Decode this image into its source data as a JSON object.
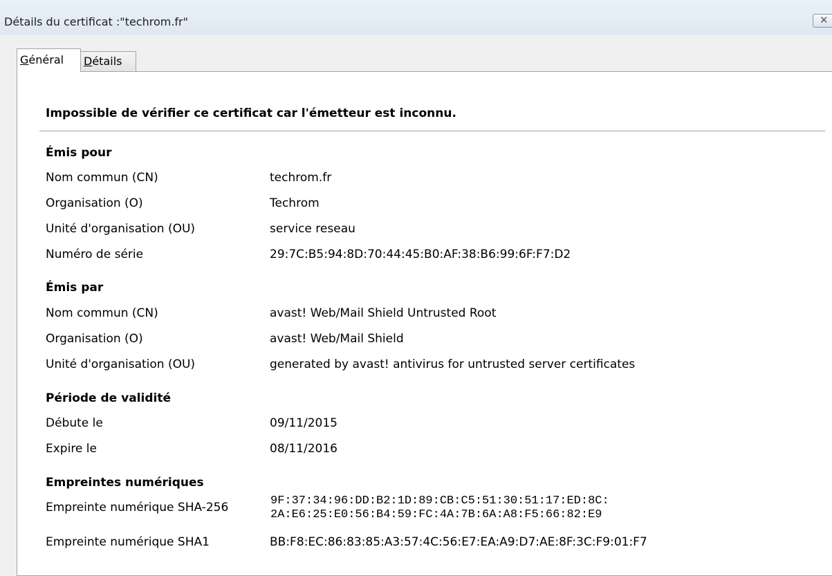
{
  "window": {
    "title": "Détails du certificat :\"techrom.fr\"",
    "close_glyph": "✕"
  },
  "tabs": [
    {
      "label": "Général",
      "underline": "G",
      "rest": "énéral",
      "selected": true
    },
    {
      "label": "Détails",
      "underline": "D",
      "rest": "étails",
      "selected": false
    }
  ],
  "warning": "Impossible de vérifier ce certificat car l'émetteur est inconnu.",
  "issued_to": {
    "heading": "Émis pour",
    "rows": [
      {
        "label": "Nom commun (CN)",
        "value": "techrom.fr"
      },
      {
        "label": "Organisation (O)",
        "value": "Techrom"
      },
      {
        "label": "Unité d'organisation (OU)",
        "value": "service reseau"
      },
      {
        "label": "Numéro de série",
        "value": "29:7C:B5:94:8D:70:44:45:B0:AF:38:B6:99:6F:F7:D2"
      }
    ]
  },
  "issued_by": {
    "heading": "Émis par",
    "rows": [
      {
        "label": "Nom commun (CN)",
        "value": "avast! Web/Mail Shield Untrusted Root"
      },
      {
        "label": "Organisation (O)",
        "value": "avast! Web/Mail Shield"
      },
      {
        "label": "Unité d'organisation (OU)",
        "value": "generated by avast! antivirus for untrusted server certificates"
      }
    ]
  },
  "validity": {
    "heading": "Période de validité",
    "rows": [
      {
        "label": "Débute le",
        "value": "09/11/2015"
      },
      {
        "label": "Expire le",
        "value": "08/11/2016"
      }
    ]
  },
  "fingerprints": {
    "heading": "Empreintes numériques",
    "sha256_label": "Empreinte numérique SHA-256",
    "sha256_line1": "9F:37:34:96:DD:B2:1D:89:CB:C5:51:30:51:17:ED:8C:",
    "sha256_line2": "2A:E6:25:E0:56:B4:59:FC:4A:7B:6A:A8:F5:66:82:E9",
    "sha1_label": "Empreinte numérique SHA1",
    "sha1_value": "BB:F8:EC:86:83:85:A3:57:4C:56:E7:EA:A9:D7:AE:8F:3C:F9:01:F7"
  }
}
